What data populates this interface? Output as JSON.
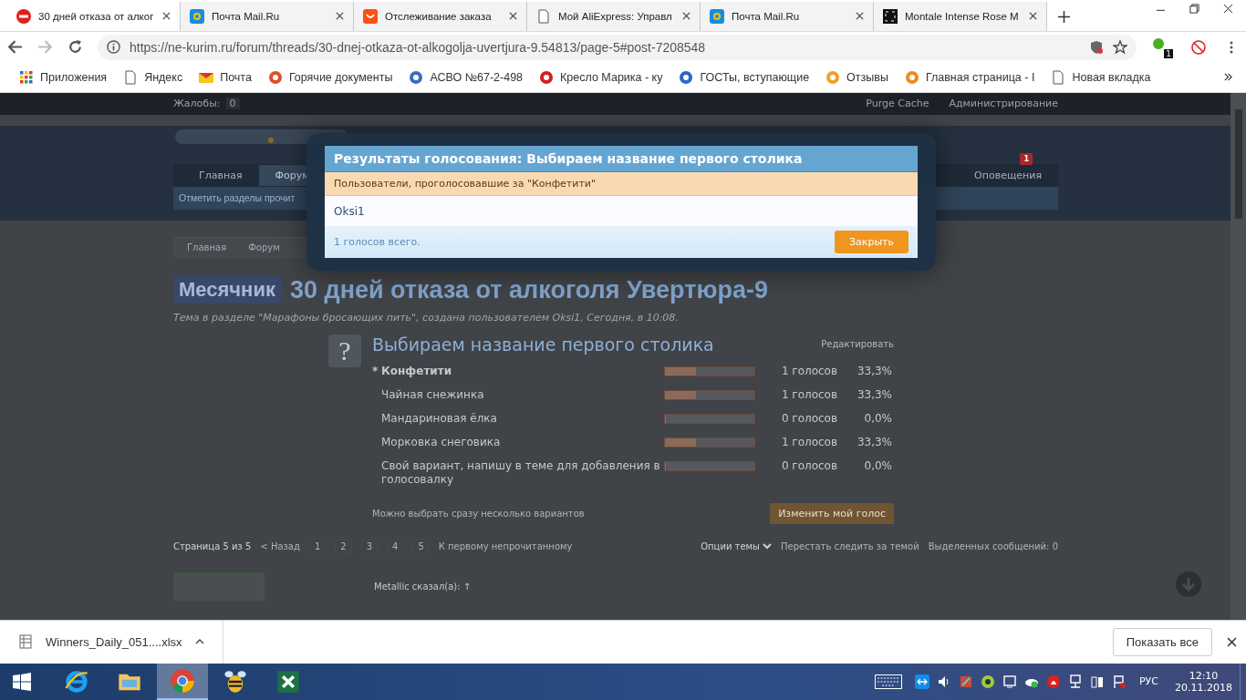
{
  "browser": {
    "tabs": [
      {
        "title": "30 дней отказа от алког",
        "kind": "stop",
        "selected": true
      },
      {
        "title": "Почта Mail.Ru",
        "kind": "mail",
        "selected": false
      },
      {
        "title": "Отслеживание заказа",
        "kind": "shop",
        "selected": false
      },
      {
        "title": "Мой AliExpress: Управл",
        "kind": "page",
        "selected": false
      },
      {
        "title": "Почта Mail.Ru",
        "kind": "mail",
        "selected": false
      },
      {
        "title": "Montale Intense Rose M",
        "kind": "frame",
        "selected": false
      }
    ],
    "url": "https://ne-kurim.ru/forum/threads/30-dnej-otkaza-ot-alkogolja-uvertjura-9.54813/page-5#post-7208548",
    "extension_badge": "1",
    "bookmarks": [
      {
        "label": "Приложения",
        "kind": "grid"
      },
      {
        "label": "Яндекс",
        "kind": "page"
      },
      {
        "label": "Почта",
        "kind": "envelope"
      },
      {
        "label": "Горячие документы",
        "kind": "globe"
      },
      {
        "label": "АСВО №67-2-498",
        "kind": "people"
      },
      {
        "label": "Кресло Марика - ку",
        "kind": "badge"
      },
      {
        "label": "ГОСТы, вступающие",
        "kind": "swirl"
      },
      {
        "label": "Отзывы",
        "kind": "check"
      },
      {
        "label": "Главная страница - I",
        "kind": "ring"
      },
      {
        "label": "Новая вкладка",
        "kind": "page"
      }
    ]
  },
  "forum": {
    "topbar": {
      "reports_label": "Жалобы:",
      "reports_count": "0",
      "links": [
        "Purge Cache",
        "Администрирование"
      ]
    },
    "nav": {
      "tabs": [
        {
          "label": "Главная",
          "selected": false
        },
        {
          "label": "Форум",
          "selected": true
        }
      ],
      "alerts": {
        "label": "Оповещения",
        "badge": "1"
      },
      "subnav": "Отметить разделы прочит"
    },
    "breadcrumbs": [
      "Главная",
      "Форум"
    ],
    "thread": {
      "prefix": "Месячник",
      "title": "30 дней отказа от алкоголя Увертюра-9",
      "meta": "Тема в разделе \"Марафоны бросающих пить\", создана пользователем Oksi1, Сегодня, в 10:08."
    },
    "poll": {
      "badge": "?",
      "mine_marker": "*",
      "title": "Выбираем название первого столика",
      "edit": "Редактировать",
      "options": [
        {
          "label": "Конфетити",
          "mine": true,
          "level": 0.333,
          "votes": "1 голосов",
          "percent": "33,3%"
        },
        {
          "label": "Чайная снежинка",
          "mine": false,
          "level": 0.333,
          "votes": "1 голосов",
          "percent": "33,3%"
        },
        {
          "label": "Мандариновая ёлка",
          "mine": false,
          "level": 0,
          "votes": "0 голосов",
          "percent": "0,0%"
        },
        {
          "label": "Морковка снеговика",
          "mine": false,
          "level": 0.333,
          "votes": "1 голосов",
          "percent": "33,3%"
        },
        {
          "label": "Свой вариант, напишу в теме для добавления в голосовалку",
          "mine": false,
          "level": 0,
          "votes": "0 голосов",
          "percent": "0,0%"
        }
      ],
      "note": "Можно выбрать сразу несколько вариантов",
      "change_vote": "Изменить мой голос"
    },
    "pagination": {
      "page_label": "Страница 5 из 5",
      "prev": "< Назад",
      "pages": [
        "1",
        "2",
        "3",
        "4",
        "5"
      ],
      "first_unread": "К первому непрочитанному",
      "thread_options": "Опции темы",
      "unwatch": "Перестать следить за темой",
      "selected_posts": "Выделенных сообщений: 0"
    },
    "post": {
      "quote_author": "Metallic сказал(а): ↑"
    }
  },
  "dialog": {
    "title": "Результаты голосования: Выбираем название первого столика",
    "subtitle": "Пользователи, проголосовавшие за \"Конфетити\"",
    "voters": [
      "Oksi1"
    ],
    "total": "1 голосов всего.",
    "close": "Закрыть"
  },
  "downloads": {
    "file": "Winners_Daily_051....xlsx",
    "show_all": "Показать все"
  },
  "taskbar": {
    "apps": [
      {
        "kind": "ie",
        "selected": false
      },
      {
        "kind": "folder",
        "selected": false
      },
      {
        "kind": "chrome",
        "selected": true
      },
      {
        "kind": "bee",
        "selected": false
      },
      {
        "kind": "excel",
        "selected": false
      }
    ],
    "language": "РУС",
    "time": "12:10",
    "date": "20.11.2018"
  }
}
